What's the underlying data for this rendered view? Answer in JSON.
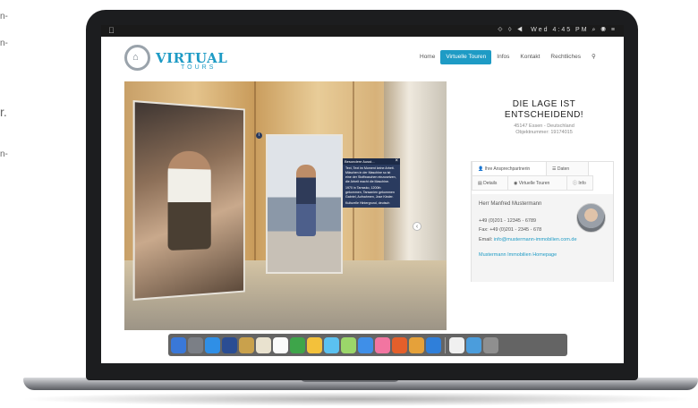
{
  "side_text": [
    "n-",
    "n-",
    "r.",
    "n-"
  ],
  "menubar": {
    "apple": "",
    "right": "⟐ ♢ ◀  Wed 4:45 PM  ⌕  ◉  ≡"
  },
  "site": {
    "logo": {
      "main": "VIRTUAL",
      "sub": "TOURS"
    },
    "nav": [
      "Home",
      "Virtuelle Touren",
      "Infos",
      "Kontakt",
      "Rechtliches"
    ],
    "nav_search_icon": "search-icon",
    "accent": "#1e9bc5"
  },
  "tour": {
    "info_title": "Besondere Ausst...",
    "info_text_1": "Text, Text im Moment keine Arbeit. Mäschen in der Maschine so ist eine der Stoffwaschen einzusetzen, die Arbeit macht die Maschine.",
    "info_text_2": "1970 in Tarrasko, 1200th gekommen, Tansanien gekommen Gabriel, Aufnahmen, Jose Kinder.",
    "info_text_3": "Kulturelle Hintergrund, deutsch",
    "close": "×",
    "info_marker": "i",
    "nav_arrow": "‹"
  },
  "content": {
    "headline": "DIE LAGE IST ENTSCHEIDEND!",
    "location": "45147 Essen - Deutschland",
    "object_number": "Objektnummer: 19174015",
    "tabs": [
      {
        "icon": "user-icon",
        "label": "Ihre Ansprechpartnerin"
      },
      {
        "icon": "list-icon",
        "label": "Daten"
      },
      {
        "icon": "document-icon",
        "label": "Details"
      },
      {
        "icon": "eye-icon",
        "label": "Virtuelle Touren"
      },
      {
        "icon": "info-icon",
        "label": "Info"
      }
    ],
    "agent": {
      "name": "Herr Manfred Mustermann",
      "phone": "+49 (0)201 - 12345 - 6789",
      "fax": "Fax: +49 (0)201 - 2345 - 678",
      "email_label": "Email:",
      "email": "info@mustermann-immobilien.com.de",
      "homepage": "Mustermann Immobilien Homepage"
    }
  },
  "dock_colors": [
    "#3a78d8",
    "#7b7f86",
    "#2f8fe6",
    "#2a4d93",
    "#c9a14c",
    "#e9e2cf",
    "#fbfbfb",
    "#3ea54a",
    "#f3c13b",
    "#5bc1f0",
    "#9bd66a",
    "#3f8fe8",
    "#f275a1",
    "#e45f2b",
    "#e5a13a",
    "#2f7fda",
    "#f0f0f0",
    "#4b9ddc",
    "#8f8f8f"
  ]
}
